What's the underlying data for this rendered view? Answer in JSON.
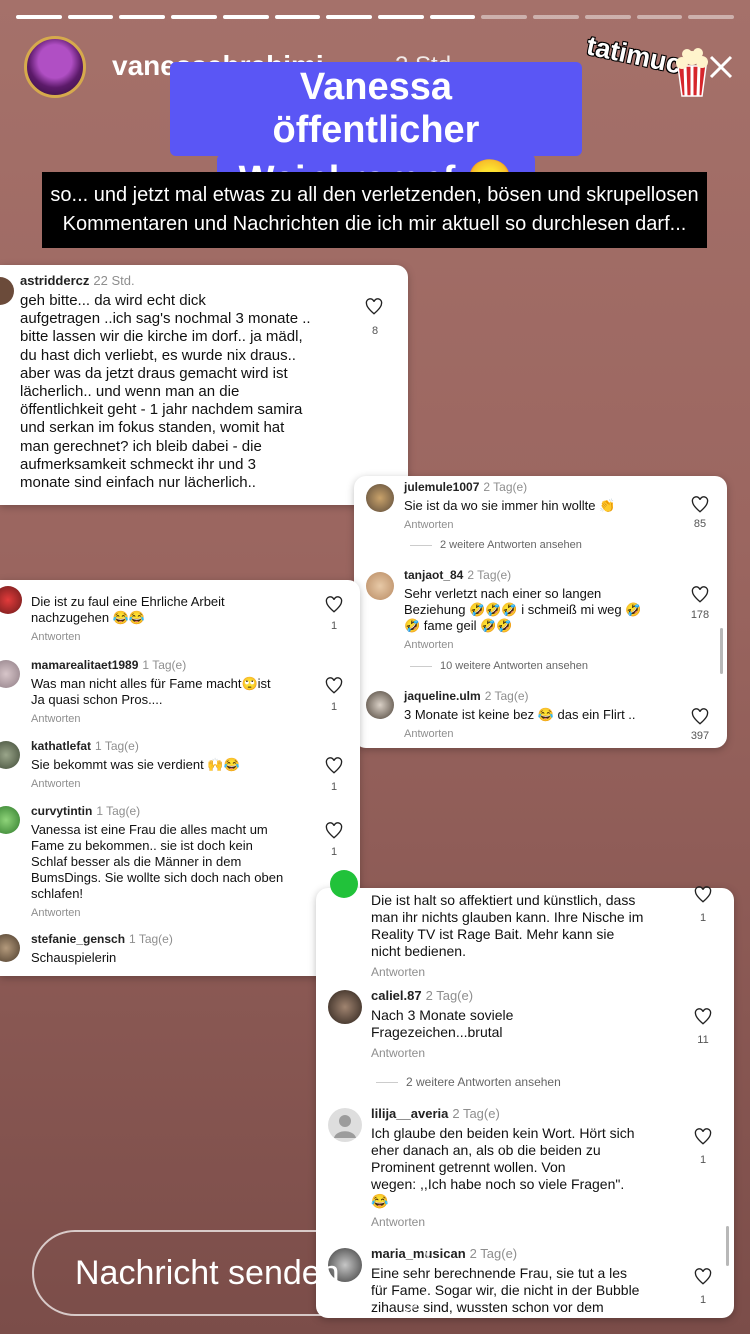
{
  "story": {
    "progress_segments_total": 14,
    "progress_segments_done": 9,
    "username": "vanessabrahimi",
    "time": "2 Std.",
    "watermark": "tatimuc",
    "title_line1": "Vanessa öffentlicher",
    "title_line2": "Weinkrampf 😐",
    "caption_line1": "so... und jetzt mal etwas zu all den verletzenden, bösen und skrupellosen",
    "caption_line2": "Kommentaren und Nachrichten die ich mir aktuell so durchlesen darf..."
  },
  "card1": {
    "user": "astriddercz",
    "time": "22 Std.",
    "text": "geh bitte... da wird echt dick\naufgetragen ..ich sag's nochmal 3 monate ..\nbitte lassen wir die kirche im dorf.. ja mädl,\ndu hast dich verliebt, es wurde nix draus..\naber was da jetzt draus gemacht wird ist\nlächerlich.. und wenn man an die\nöffentlichkeit geht - 1 jahr nachdem samira\nund serkan im fokus standen, womit hat\nman gerechnet? ich bleib dabei - die\naufmerksamkeit schmeckt ihr und 3\nmonate sind einfach nur lächerlich..",
    "likes": "8"
  },
  "card2": {
    "comments": [
      {
        "user": "julemule1007",
        "time": "2 Tag(e)",
        "text": "Sie ist da wo sie immer hin wollte 👏",
        "reply": "Antworten",
        "likes": "85",
        "more": "2 weitere Antworten ansehen"
      },
      {
        "user": "tanjaot_84",
        "time": "2 Tag(e)",
        "text": "Sehr verletzt nach einer so langen\nBeziehung 🤣🤣🤣 i schmeiß mi weg 🤣\n🤣 fame geil 🤣🤣",
        "reply": "Antworten",
        "likes": "178",
        "more": "10 weitere Antworten ansehen"
      },
      {
        "user": "jaqueline.ulm",
        "time": "2 Tag(e)",
        "text": "3 Monate ist keine bez 😂 das ein Flirt ..",
        "reply": "Antworten",
        "likes": "397"
      }
    ]
  },
  "card3": {
    "comments": [
      {
        "user": "",
        "time": "",
        "text": "Die ist zu faul eine Ehrliche Arbeit\nnachzugehen 😂😂",
        "reply": "Antworten",
        "likes": "1"
      },
      {
        "user": "mamarealitaet1989",
        "time": "1 Tag(e)",
        "text": "Was man nicht alles für Fame macht🙄ist\nJa quasi schon Pros....",
        "reply": "Antworten",
        "likes": "1"
      },
      {
        "user": "kathatlefat",
        "time": "1 Tag(e)",
        "text": "Sie bekommt was sie verdient 🙌😂",
        "reply": "Antworten",
        "likes": "1"
      },
      {
        "user": "curvytintin",
        "time": "1 Tag(e)",
        "text": "Vanessa ist eine Frau die alles macht um\nFame zu bekommen.. sie ist doch kein\nSchlaf besser als die Männer in dem\nBumsDings. Sie wollte sich doch nach oben\nschlafen!",
        "reply": "Antworten",
        "likes": "1"
      },
      {
        "user": "stefanie_gensch",
        "time": "1 Tag(e)",
        "text": "Schauspielerin",
        "reply": "",
        "likes": ""
      }
    ]
  },
  "card4": {
    "comments": [
      {
        "user": "",
        "time": "",
        "text": "Die ist halt so affektiert und künstlich, dass\nman ihr nichts glauben kann. Ihre Nische im\nReality TV ist Rage Bait. Mehr kann sie\nnicht bedienen.",
        "reply": "Antworten",
        "likes": "1"
      },
      {
        "user": "caliel.87",
        "time": "2 Tag(e)",
        "text": "Nach 3 Monate soviele\nFragezeichen...brutal",
        "reply": "Antworten",
        "likes": "11",
        "more": "2 weitere Antworten ansehen"
      },
      {
        "user": "lilija__averia",
        "time": "2 Tag(e)",
        "text": "Ich glaube den beiden kein Wort. Hört sich\neher danach an, als ob die beiden zu\nProminent getrennt wollen. Von\nwegen: ,,Ich habe noch so viele Fragen\".\n😂",
        "reply": "Antworten",
        "likes": "1"
      },
      {
        "user": "maria_musican",
        "time": "2 Tag(e)",
        "text": "Eine sehr berechnende Frau, sie tut a les\nfür Fame. Sogar wir, die nicht in der Bubble\nzihause sind, wussten schon vor dem",
        "reply": "",
        "likes": "1"
      }
    ]
  },
  "message": {
    "placeholder": "Nachricht senden"
  }
}
